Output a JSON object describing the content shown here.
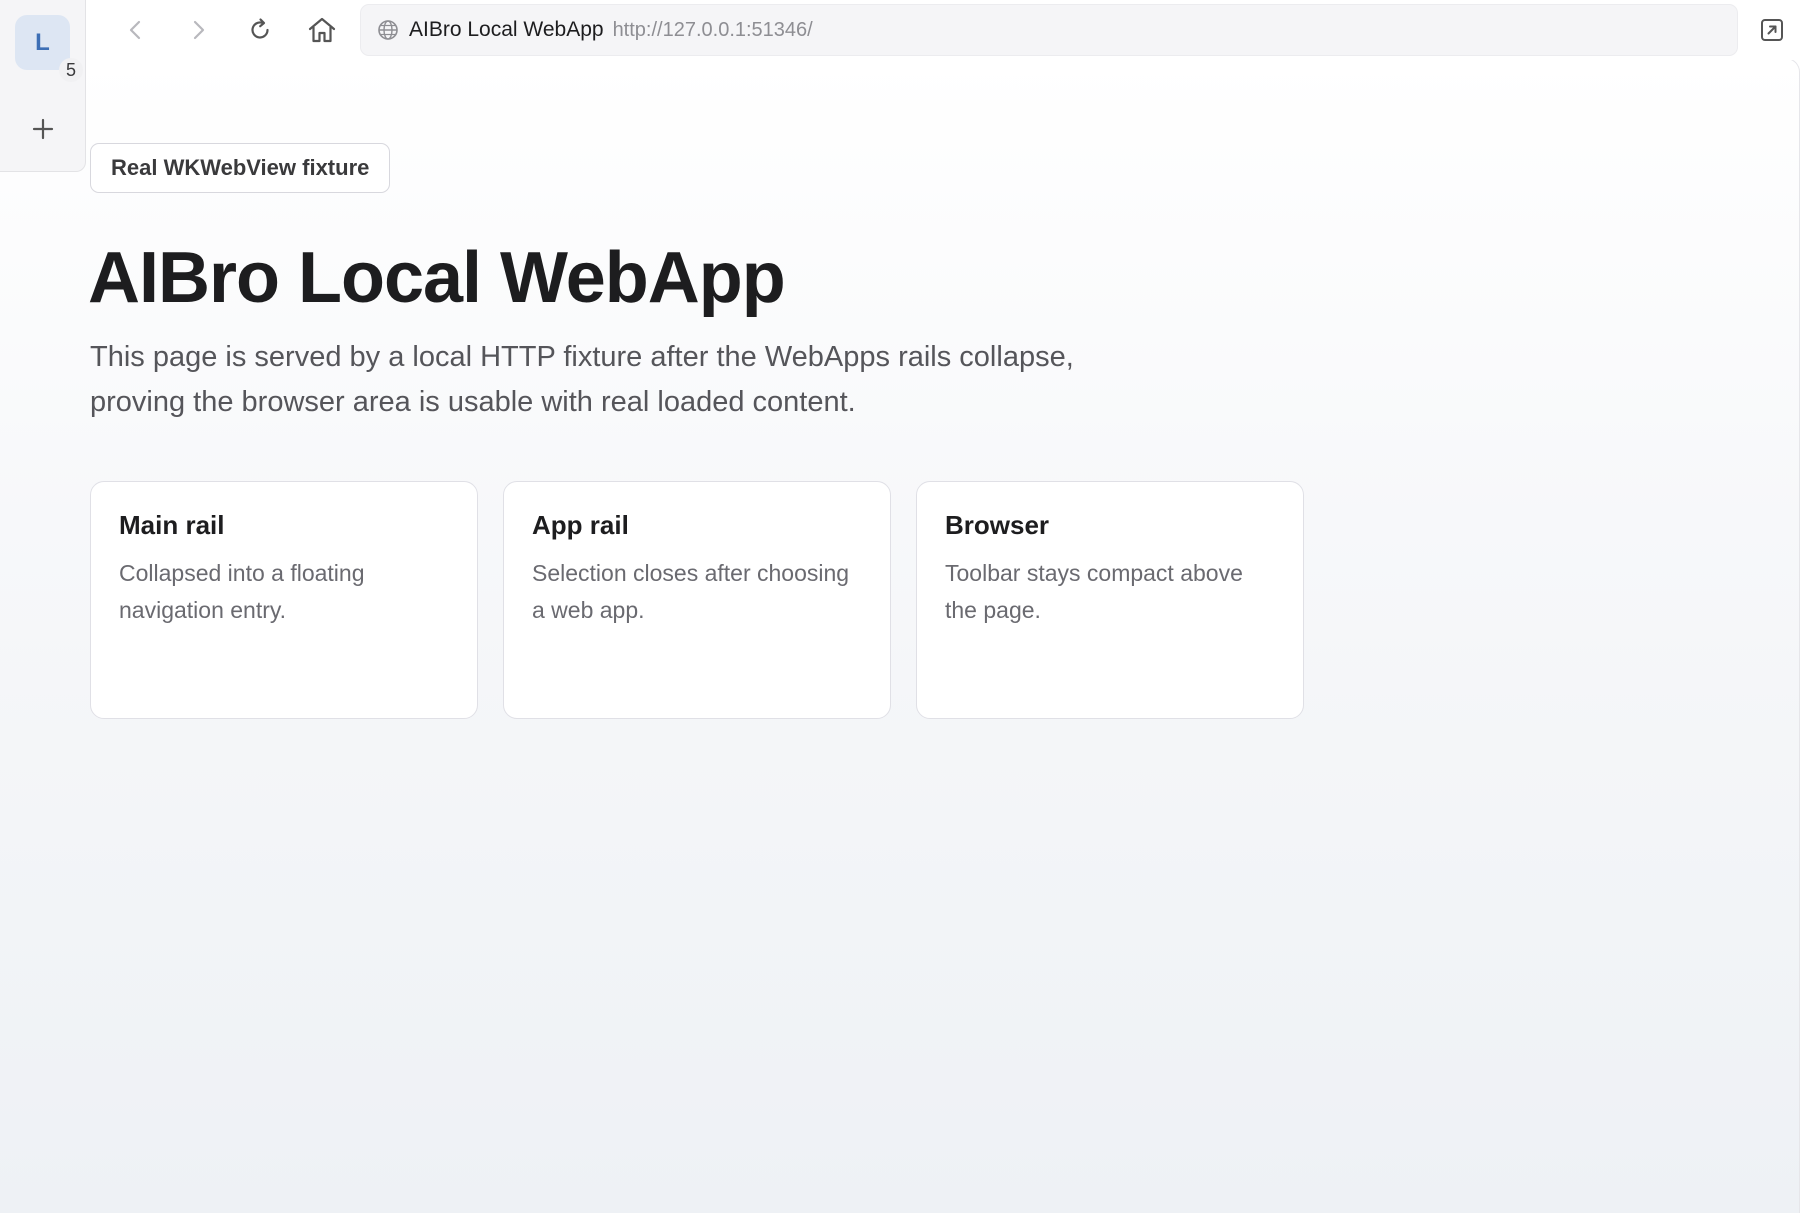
{
  "rail": {
    "avatar_letter": "L",
    "badge_count": "5",
    "add_icon": "plus-icon"
  },
  "toolbar": {
    "back_icon": "chevron-left-icon",
    "forward_icon": "chevron-right-icon",
    "reload_icon": "reload-icon",
    "home_icon": "home-icon",
    "open_external_icon": "open-external-icon",
    "address": {
      "page_title": "AIBro Local WebApp",
      "url": "http://127.0.0.1:51346/",
      "icon": "globe-icon"
    }
  },
  "page": {
    "pill_label": "Real WKWebView fixture",
    "title": "AIBro Local WebApp",
    "description": "This page is served by a local HTTP fixture after the WebApps rails collapse, proving the browser area is usable with real loaded content.",
    "cards": [
      {
        "title": "Main rail",
        "body": "Collapsed into a floating navigation entry."
      },
      {
        "title": "App rail",
        "body": "Selection closes after choosing a web app."
      },
      {
        "title": "Browser",
        "body": "Toolbar stays compact above the page."
      }
    ]
  },
  "colors": {
    "avatar_bg": "#dde6f3",
    "avatar_fg": "#3d6fb5",
    "text_primary": "#1d1d1f",
    "text_secondary": "#55555a"
  }
}
